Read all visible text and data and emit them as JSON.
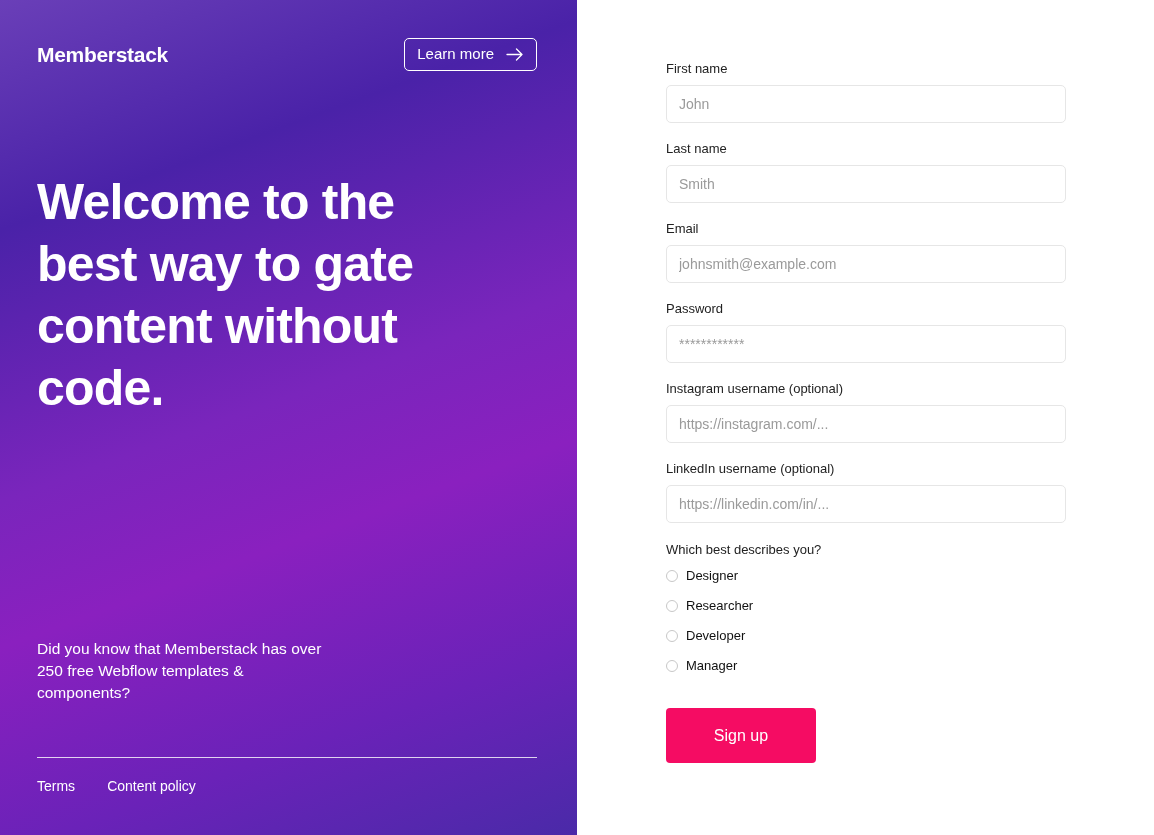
{
  "brand": {
    "logo": "Memberstack",
    "learn_more": "Learn more"
  },
  "headline": "Welcome to the best way to gate content without code.",
  "promo": "Did you know that Memberstack has over 250 free Webflow templates & components?",
  "footer_links": [
    "Terms",
    "Content policy"
  ],
  "form": {
    "fields": [
      {
        "label": "First name",
        "placeholder": "John"
      },
      {
        "label": "Last name",
        "placeholder": "Smith"
      },
      {
        "label": "Email",
        "placeholder": "johnsmith@example.com"
      },
      {
        "label": "Password",
        "placeholder": "************"
      },
      {
        "label": "Instagram username (optional)",
        "placeholder": "https://instagram.com/..."
      },
      {
        "label": "LinkedIn username (optional)",
        "placeholder": "https://linkedin.com/in/..."
      }
    ],
    "question": "Which best describes you?",
    "options": [
      {
        "label": "Designer",
        "selected": false
      },
      {
        "label": "Researcher",
        "selected": false
      },
      {
        "label": "Developer",
        "selected": false
      },
      {
        "label": "Manager",
        "selected": false
      }
    ],
    "submit": "Sign up"
  }
}
